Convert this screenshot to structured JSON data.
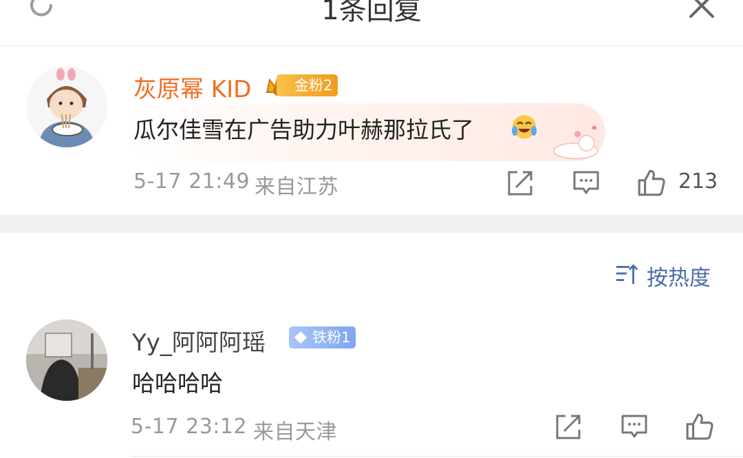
{
  "header": {
    "title": "1条回复"
  },
  "main_comment": {
    "username": "灰原幂 KID",
    "badge": "金粉2",
    "text": "瓜尔佳雪在广告助力叶赫那拉氏了",
    "time": "5-17 21:49",
    "location": "来自江苏",
    "like_count": "213"
  },
  "sort": {
    "label": "按热度"
  },
  "reply": {
    "username": "Yy_阿阿阿瑶",
    "badge": "铁粉1",
    "text": "哈哈哈哈",
    "time": "5-17 23:12",
    "location": "来自天津"
  },
  "colors": {
    "name_orange": "#f26d1f",
    "gold_badge": "#f5a623",
    "blue_badge": "#8ab4f8",
    "link_blue": "#4a6da8"
  }
}
